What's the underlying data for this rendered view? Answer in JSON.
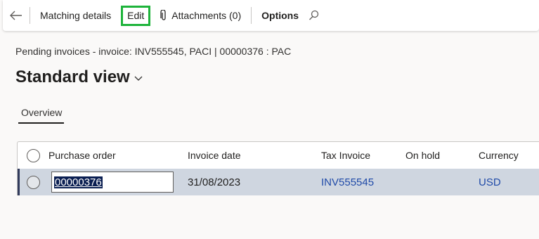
{
  "toolbar": {
    "matching_details": "Matching details",
    "edit": "Edit",
    "attachments": "Attachments (0)",
    "options": "Options"
  },
  "caption": "Pending invoices - invoice: INV555545, PACI  |  00000376 : PAC",
  "view_title": "Standard view",
  "tabs": [
    "Overview"
  ],
  "grid": {
    "columns": [
      "Purchase order",
      "Invoice date",
      "Tax Invoice",
      "On hold",
      "Currency"
    ],
    "rows": [
      {
        "purchase_order": "00000376",
        "invoice_date": "31/08/2023",
        "tax_invoice": "INV555545",
        "on_hold": "",
        "currency": "USD"
      }
    ]
  },
  "colors": {
    "highlight_border": "#1db33a",
    "selected_row": "#cfd6e0",
    "link": "#1f4aa8"
  }
}
